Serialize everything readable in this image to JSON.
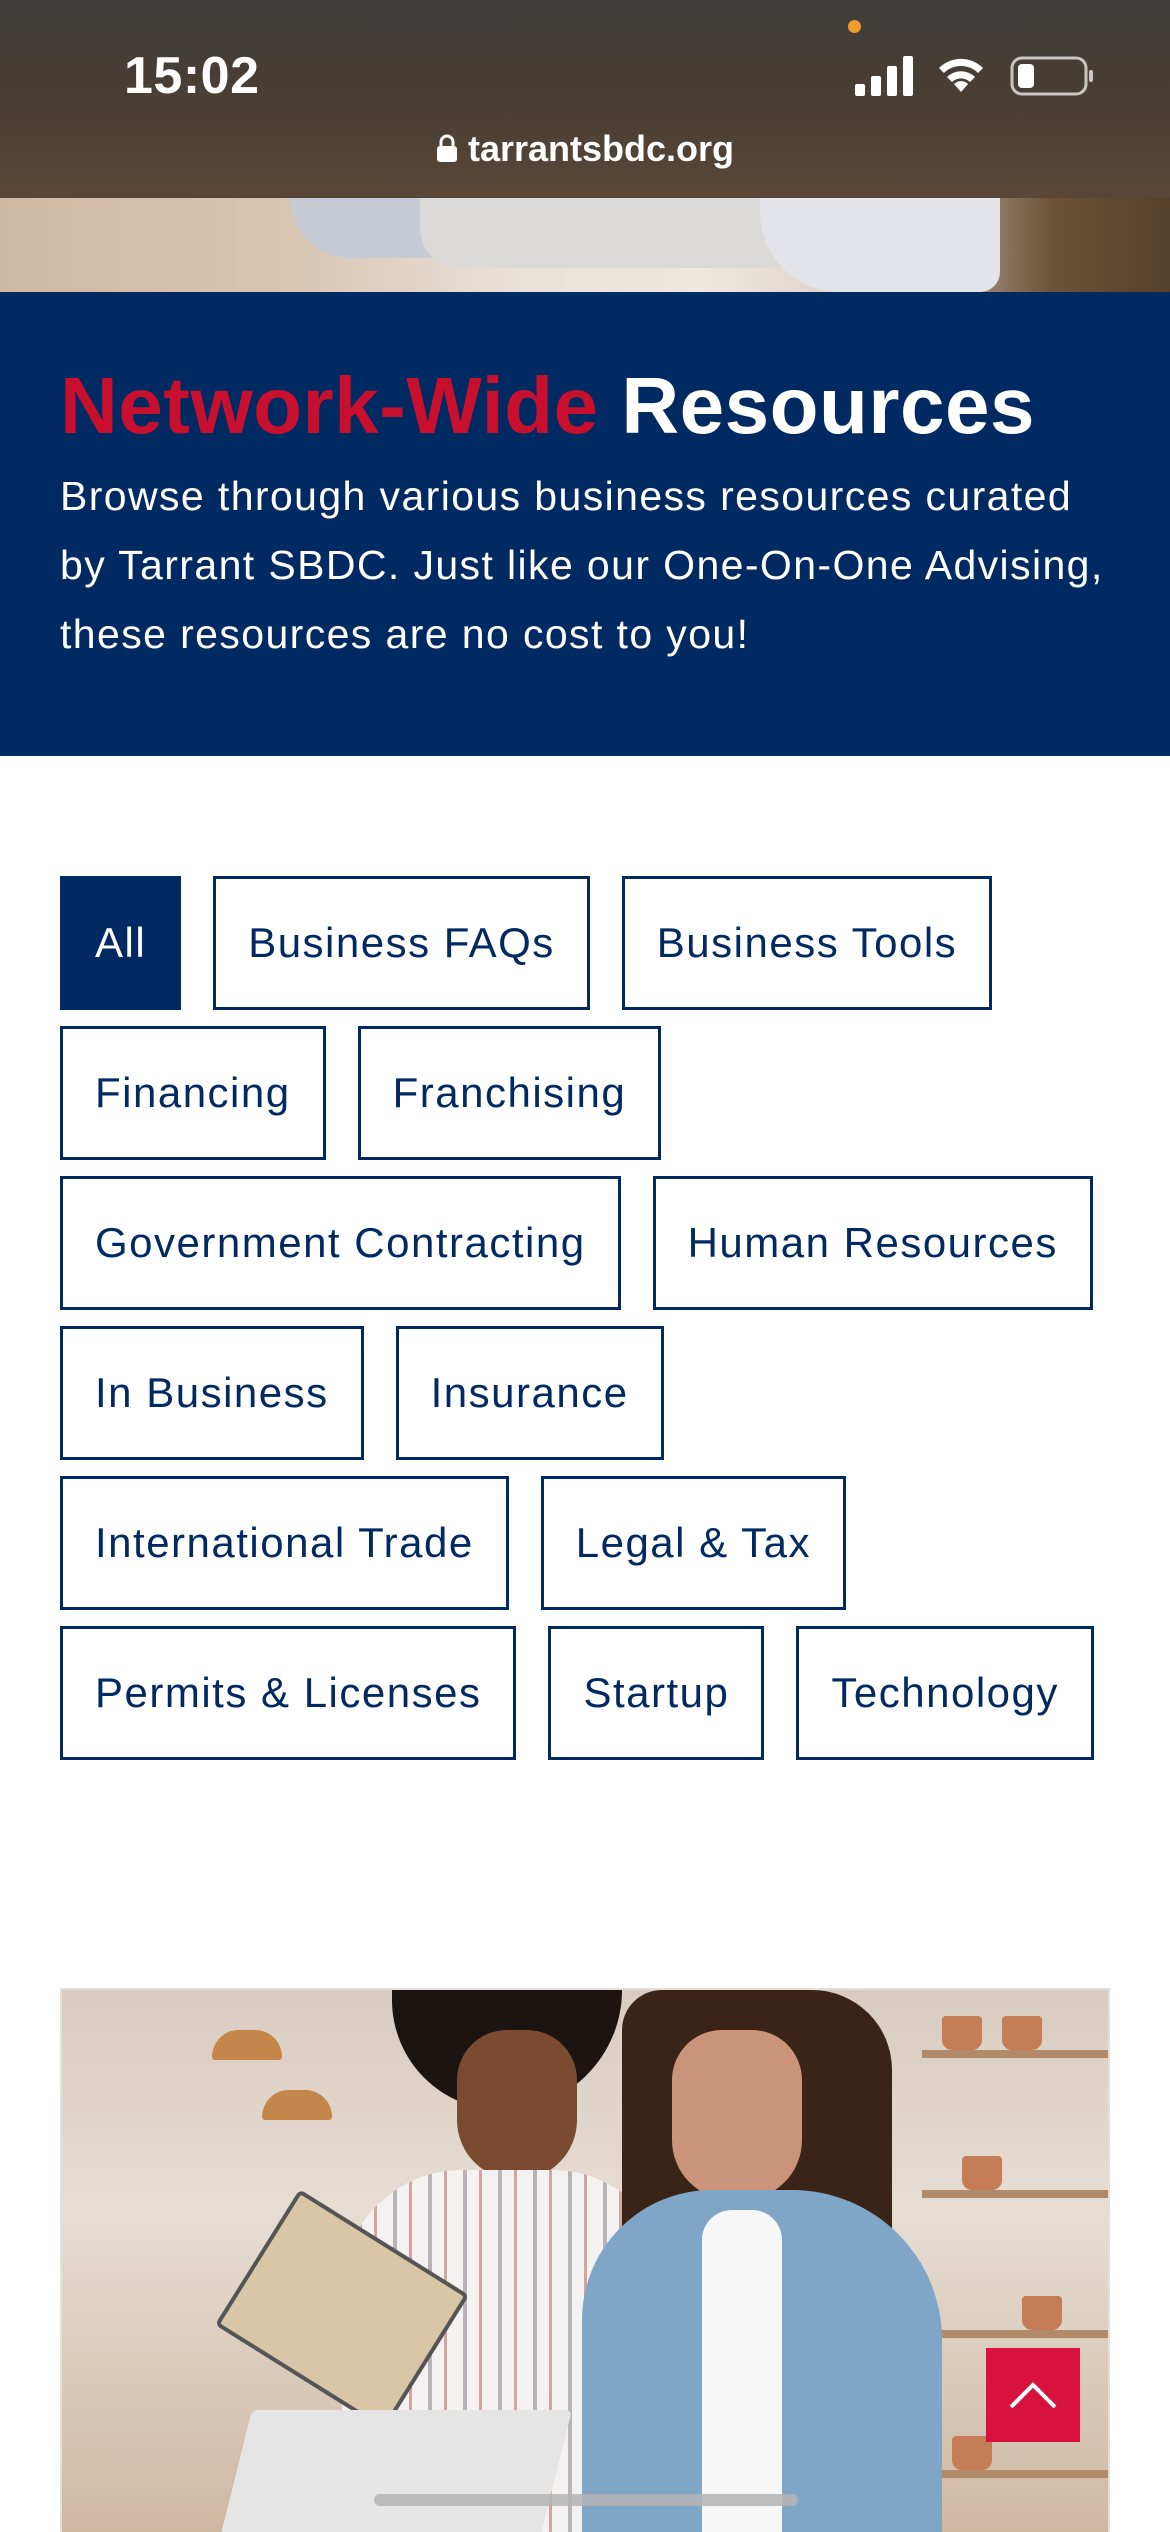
{
  "status_bar": {
    "time": "15:02",
    "url": "tarrantsbdc.org",
    "icons": [
      "signal-icon",
      "wifi-icon",
      "battery-icon",
      "lock-icon"
    ]
  },
  "banner": {
    "title_accent": "Network-Wide",
    "title_rest": "Resources",
    "description": "Browse through various business resources curated by Tarrant SBDC. Just like our One-On-One Advising, these resources are no cost to you!"
  },
  "filters": [
    {
      "label": "All",
      "active": true
    },
    {
      "label": "Business FAQs",
      "active": false
    },
    {
      "label": "Business Tools",
      "active": false
    },
    {
      "label": "Financing",
      "active": false
    },
    {
      "label": "Franchising",
      "active": false
    },
    {
      "label": "Government Contracting",
      "active": false
    },
    {
      "label": "Human Resources",
      "active": false
    },
    {
      "label": "In Business",
      "active": false
    },
    {
      "label": "Insurance",
      "active": false
    },
    {
      "label": "International Trade",
      "active": false
    },
    {
      "label": "Legal & Tax",
      "active": false
    },
    {
      "label": "Permits & Licenses",
      "active": false
    },
    {
      "label": "Startup",
      "active": false
    },
    {
      "label": "Technology",
      "active": false
    }
  ],
  "colors": {
    "navy": "#022a62",
    "accent_red": "#c8102e",
    "scroll_button": "#d8123f"
  }
}
